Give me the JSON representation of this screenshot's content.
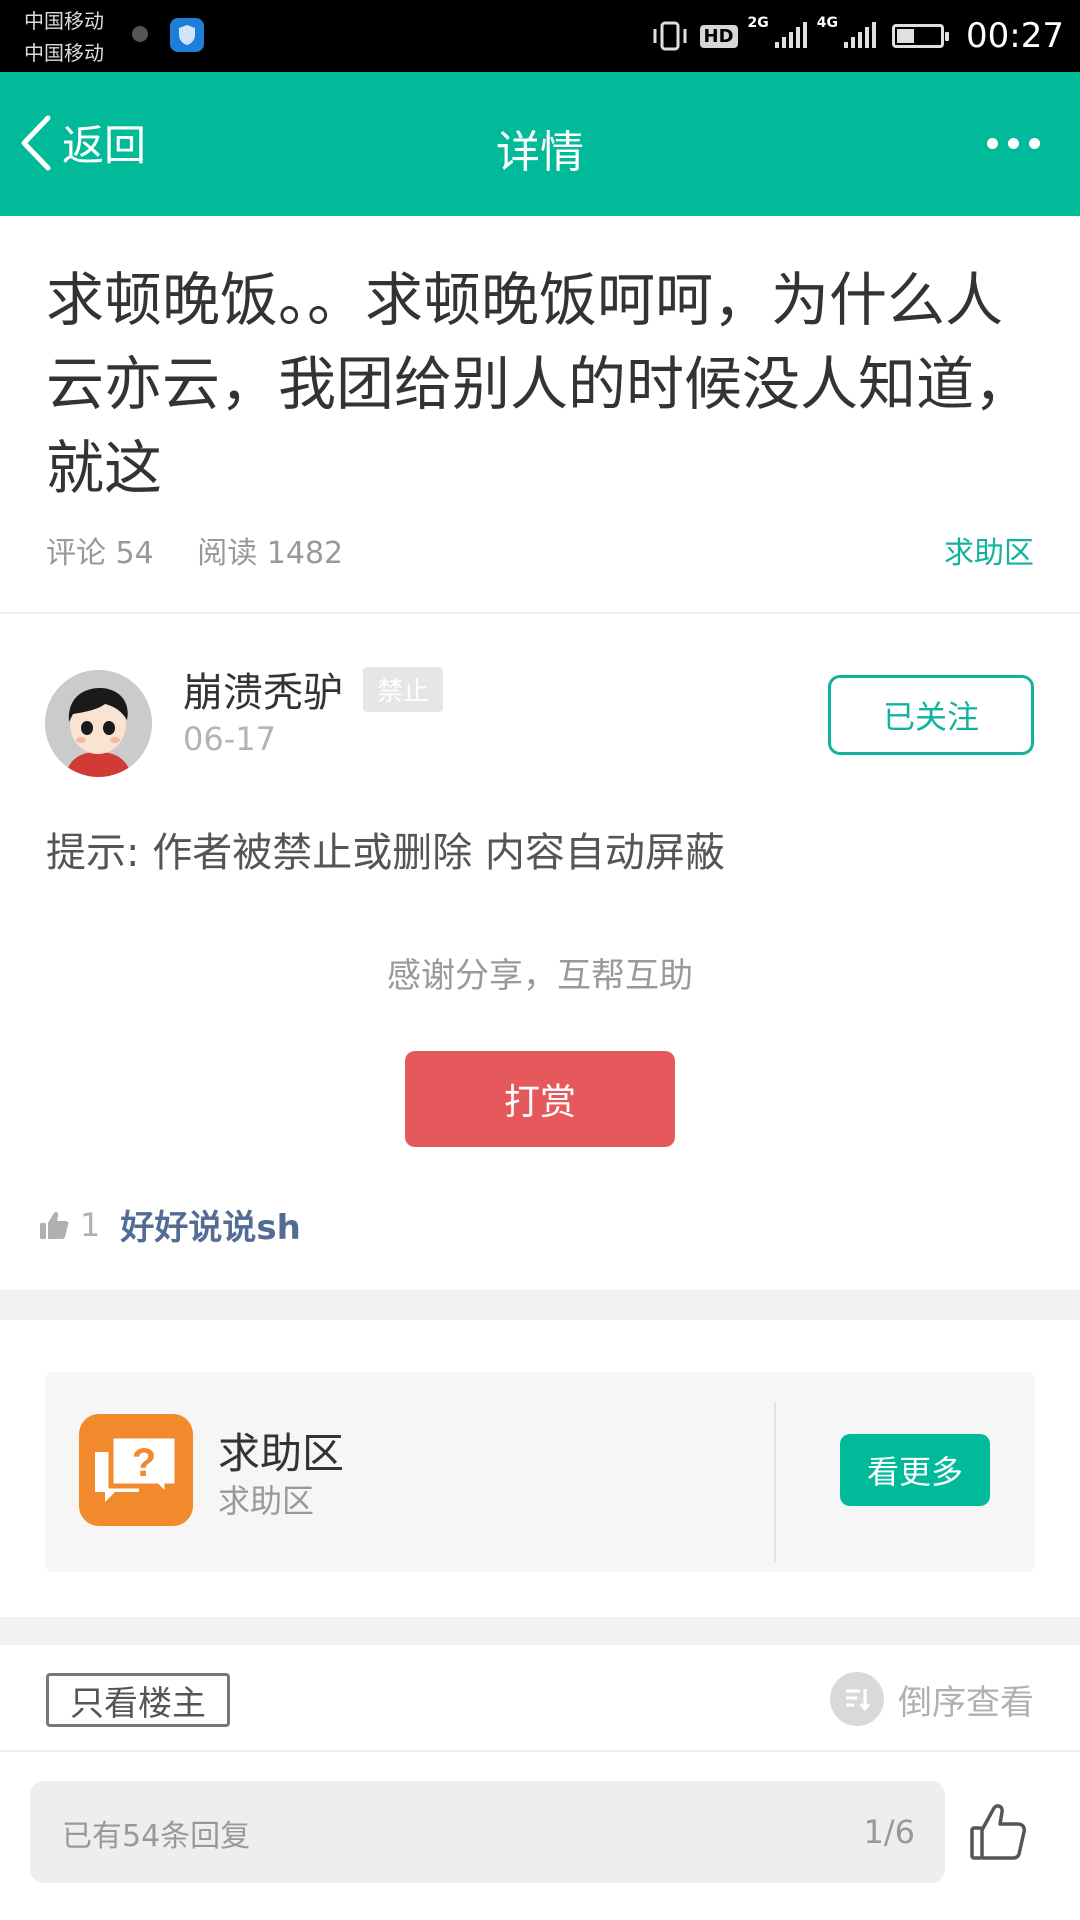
{
  "status_bar": {
    "carrier_1": "中国移动",
    "carrier_2": "中国移动",
    "hd": "HD",
    "network_1": "2G",
    "network_2": "4G",
    "time": "00:27",
    "battery_level": 0.4
  },
  "nav": {
    "back_label": "返回",
    "title": "详情"
  },
  "post": {
    "title": "求顿晚饭。。求顿晚饭呵呵，为什么人云亦云，我团给别人的时候没人知道，就这",
    "comments_label": "评论 54",
    "reads_label": "阅读 1482",
    "board": "求助区"
  },
  "author": {
    "name": "崩溃秃驴",
    "tag": "禁止",
    "date": "06-17",
    "follow_label": "已关注"
  },
  "content": {
    "notice": "提示: 作者被禁止或删除 内容自动屏蔽",
    "thanks": "感谢分享，互帮互助",
    "reward_label": "打赏"
  },
  "likes": {
    "count": "1",
    "liker": "好好说说sh"
  },
  "board_card": {
    "name": "求助区",
    "subtitle": "求助区",
    "more_label": "看更多"
  },
  "comments_bar": {
    "host_only_label": "只看楼主",
    "sort_label": "倒序查看"
  },
  "reply_bar": {
    "placeholder": "已有54条回复",
    "page": "1/6"
  },
  "colors": {
    "brand": "#00ba99",
    "reward": "#e5585b",
    "board_icon": "#f28a2d",
    "liker": "#546b94"
  }
}
